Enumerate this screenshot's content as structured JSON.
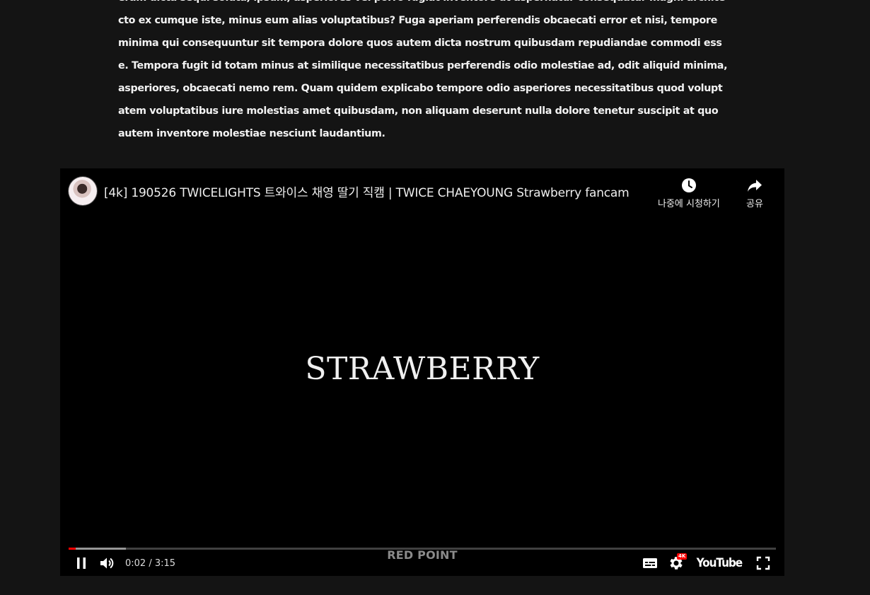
{
  "article": {
    "paragraph": "eram dicta sequi soluta, ipsum, asperiores vel porro fugiat inventore ut aspernatur consequatur magni architecto ex cumque iste, minus eum alias voluptatibus? Fuga aperiam perferendis obcaecati error et nisi, tempore minima qui consequuntur sit tempora dolore quos autem dicta nostrum quibusdam repudiandae commodi esse. Tempora fugit id totam minus at similique necessitatibus perferendis odio molestiae ad, odit aliquid minima, asperiores, obcaecati nemo rem. Quam quidem explicabo tempore odio asperiores necessitatibus quod voluptatem voluptatibus iure molestias amet quibusdam, non aliquam deserunt nulla dolore tenetur suscipit at quo autem inventore molestiae nesciunt laudantium."
  },
  "player": {
    "title": "[4k] 190526 TWICELIGHTS 트와이스 채영 딸기 직캠 |  TWICE CHAEYOUNG Strawberry fancam",
    "watch_later_label": "나중에 시청하기",
    "share_label": "공유",
    "overlay_title": "STRAWBERRY",
    "overlay_subtitle": "RED POINT",
    "current_time": "0:02",
    "duration": "3:15",
    "time_display": "0:02 / 3:15",
    "played_fraction": 0.0103,
    "buffered_fraction": 0.081,
    "quality_badge": "4K",
    "logo_text": "YouTube",
    "icons": [
      "clock-icon",
      "share-arrow-icon",
      "pause-icon",
      "volume-icon",
      "subtitles-icon",
      "gear-icon",
      "fullscreen-icon"
    ],
    "colors": {
      "progress_played": "#ff0000",
      "badge": "#ff0000",
      "background": "#000000",
      "page_background": "#141414"
    }
  }
}
